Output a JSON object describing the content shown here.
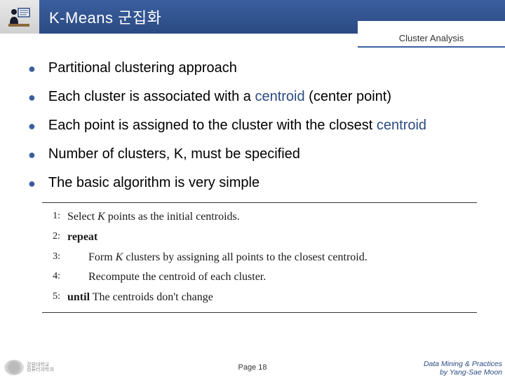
{
  "header": {
    "title": "K-Means 군집화",
    "subtitle": "Cluster Analysis"
  },
  "bullets": [
    {
      "text": "Partitional clustering approach"
    },
    {
      "text_a": "Each cluster is associated with a ",
      "hi": "centroid",
      "text_b": " (center point)"
    },
    {
      "text_a": "Each point is assigned to the cluster with the closest ",
      "hi": "centroid",
      "text_b": ""
    },
    {
      "text": "Number of clusters, K, must be specified"
    },
    {
      "text": "The basic algorithm is very simple"
    }
  ],
  "algorithm": [
    {
      "n": "1:",
      "indent": 0,
      "html": "Select <span class='kvar'>K</span> points as the initial centroids."
    },
    {
      "n": "2:",
      "indent": 0,
      "html": "<span class='bold'>repeat</span>"
    },
    {
      "n": "3:",
      "indent": 1,
      "html": "Form <span class='kvar'>K</span> clusters by assigning all points to the closest centroid."
    },
    {
      "n": "4:",
      "indent": 1,
      "html": "Recompute the centroid of each cluster."
    },
    {
      "n": "5:",
      "indent": 0,
      "html": "<span class='bold'>until</span> The centroids don't change"
    }
  ],
  "footer": {
    "logo_text_a": "강원대학교",
    "logo_text_b": "컴퓨터과학과",
    "page": "Page 18",
    "credit_a": "Data Mining & Practices",
    "credit_b": "by Yang-Sae Moon"
  }
}
